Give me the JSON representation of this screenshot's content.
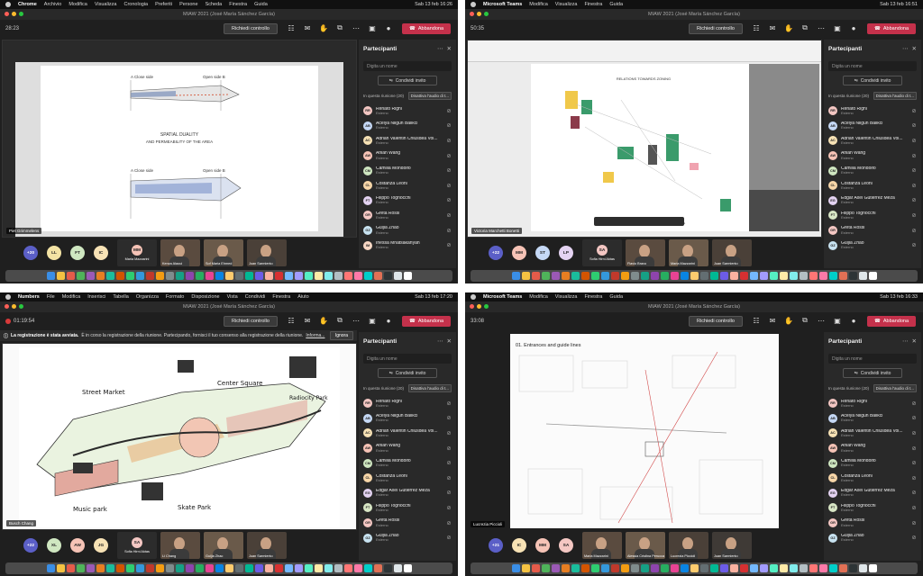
{
  "meeting_title": "MIAW 2021 (José María Sánchez García)",
  "colors": {
    "leave_button": "#c4314b",
    "panel_bg": "#292929",
    "more_badge": "#5b5fc7"
  },
  "labels": {
    "request_control": "Richiedi controllo",
    "leave": "Abbandona",
    "participants": "Partecipanti",
    "search_placeholder": "Digita un nome",
    "invite": "Condividi invito",
    "in_meeting": "In questa riunione (20)",
    "mute_all": "Disattiva l'audio di t...",
    "guest_role": "Esterno"
  },
  "participants": [
    {
      "name": "Renato Righi",
      "initials": "RR",
      "color": "#f4c7c3"
    },
    {
      "name": "Acelya Nilgun Balikci",
      "initials": "AB",
      "color": "#c5d8f5"
    },
    {
      "name": "Adrian Valentin Chiusdea Vol...",
      "initials": "AC",
      "color": "#f7e2b5"
    },
    {
      "name": "Anlan Wang",
      "initials": "AW",
      "color": "#f6c3b6"
    },
    {
      "name": "Camilla Mondolfo",
      "initials": "CM",
      "color": "#cfe7c1"
    },
    {
      "name": "Costanza Leoni",
      "initials": "CL",
      "color": "#f7d6a8"
    },
    {
      "name": "Filippo Tognocchi",
      "initials": "FT",
      "color": "#e4d3f2"
    },
    {
      "name": "Greta Rossi",
      "initials": "GR",
      "color": "#f4c7c3"
    },
    {
      "name": "Guijia Zhao",
      "initials": "GZ",
      "color": "#c8e3f1"
    },
    {
      "name": "Inessa Mnatsakanyan",
      "initials": "IM",
      "color": "#f7d7c4"
    }
  ],
  "participants_b": [
    {
      "name": "Renato Righi",
      "initials": "RR",
      "color": "#f4c7c3"
    },
    {
      "name": "Acelya Nilgun Balikci",
      "initials": "AB",
      "color": "#c5d8f5"
    },
    {
      "name": "Adrian Valentin Chiusdea Vol...",
      "initials": "AC",
      "color": "#f7e2b5"
    },
    {
      "name": "Anlan Wang",
      "initials": "AW",
      "color": "#f6c3b6"
    },
    {
      "name": "Camilla Mondolfo",
      "initials": "CM",
      "color": "#cfe7c1"
    },
    {
      "name": "Costanza Leoni",
      "initials": "CL",
      "color": "#f7d6a8"
    },
    {
      "name": "Edgar Axel Gutierrez Meza",
      "initials": "EG",
      "color": "#e4d3f2"
    },
    {
      "name": "Filippo Tognocchi",
      "initials": "FT",
      "color": "#d8e6c5"
    },
    {
      "name": "Greta Rossi",
      "initials": "GR",
      "color": "#f4c7c3"
    },
    {
      "name": "Guijia Zhao",
      "initials": "GZ",
      "color": "#c8e3f1"
    }
  ],
  "q1": {
    "app": "Chrome",
    "menus": [
      "Archivio",
      "Modifica",
      "Visualizza",
      "Cronologia",
      "Preferiti",
      "Persone",
      "Scheda",
      "Finestra",
      "Guida"
    ],
    "clock": "Sab 13 feb 16:26",
    "timer": "28:23",
    "presenter": "Piet Grimmelens",
    "doc": {
      "label_a1": "A Close side",
      "label_b1": "Open side B",
      "caption1": "SPATIAL DUALITY",
      "caption2": "AND PERMEABILITY OF THE AREA",
      "label_a2": "A Close side",
      "label_b2": "Open side B"
    },
    "strip": {
      "more": "+20",
      "circles": [
        {
          "i": "LL",
          "c": "#f3e3a4"
        },
        {
          "i": "FT",
          "c": "#cfe7c1"
        },
        {
          "i": "IC",
          "c": "#f7e2b5"
        }
      ],
      "tiles": [
        "Maria Mazzarini",
        "Kenza Alaoui",
        "Sof Maria Ehmed",
        "Juan Sarmiento"
      ],
      "mm": "MM"
    }
  },
  "q2": {
    "app": "Microsoft Teams",
    "menus": [
      "Modifica",
      "Visualizza",
      "Finestra",
      "Guida"
    ],
    "clock": "Sab 13 feb 16:51",
    "timer": "50:35",
    "presenter": "Victoria Marchetti Bonetti",
    "doc": {
      "title": "RELATIONS TOWARDS ZONING",
      "footer": "GROUP 4 | DESIGN GUIDE | MAP OF SPACES TO STAY IN ZONES"
    },
    "strip": {
      "more": "+22",
      "circles": [
        {
          "i": "MM",
          "c": "#f6c3b6"
        },
        {
          "i": "ST",
          "c": "#c5d8f5"
        },
        {
          "i": "LP",
          "c": "#e4d3f2"
        }
      ],
      "sa": "SA",
      "tiles": [
        "Sofia Hirni Aktas",
        "Flavio Bravo",
        "Maria Mazzarini",
        "Juan Sarmiento"
      ]
    }
  },
  "q3": {
    "app": "Numbers",
    "menus": [
      "File",
      "Modifica",
      "Inserisci",
      "Tabella",
      "Organizza",
      "Formato",
      "Disposizione",
      "Vista",
      "Condividi",
      "Finestra",
      "Aiuto"
    ],
    "clock": "Sab 13 feb 17:20",
    "timer": "01:19:54",
    "banner_title": "La registrazione è stata avviata.",
    "banner_text": "È in corso la registrazione della riunione. Partecipando, fornisci il tuo consenso alla registrazione della riunione.",
    "banner_link": "Informa...",
    "banner_ignore": "Ignora",
    "presenter": "Busch Chang",
    "sketch": {
      "street_market": "Street Market",
      "center_square": "Center Square",
      "radiocity_park": "Radiocity Park",
      "music_park": "Music park",
      "skate_park": "Skate Park"
    },
    "strip": {
      "more": "+22",
      "circles": [
        {
          "i": "XL",
          "c": "#cfe7c1"
        },
        {
          "i": "AW",
          "c": "#f6c3b6"
        },
        {
          "i": "JG",
          "c": "#f7e2b5"
        }
      ],
      "sa": "SA",
      "tiles": [
        "Sofia Hirni Aktas",
        "Li Chang",
        "Guijia Zhao",
        "Juan Sarmiento"
      ]
    }
  },
  "q4": {
    "app": "Microsoft Teams",
    "menus": [
      "Modifica",
      "Visualizza",
      "Finestra",
      "Guida"
    ],
    "clock": "Sab 13 feb 16:33",
    "timer": "33:08",
    "presenter": "Lucrezia Piccioli",
    "doc": {
      "title": "01. Entrances and guide lines"
    },
    "strip": {
      "more": "+21",
      "circles": [
        {
          "i": "IC",
          "c": "#f7e2b5"
        },
        {
          "i": "MM",
          "c": "#f6c3b6"
        },
        {
          "i": "SA",
          "c": "#f4c7c3"
        }
      ],
      "tiles": [
        "Maria Mazzarini",
        "Alessia Cristina Perucca",
        "Lucrezia Piccioli",
        "Juan Sarmiento"
      ]
    }
  }
}
